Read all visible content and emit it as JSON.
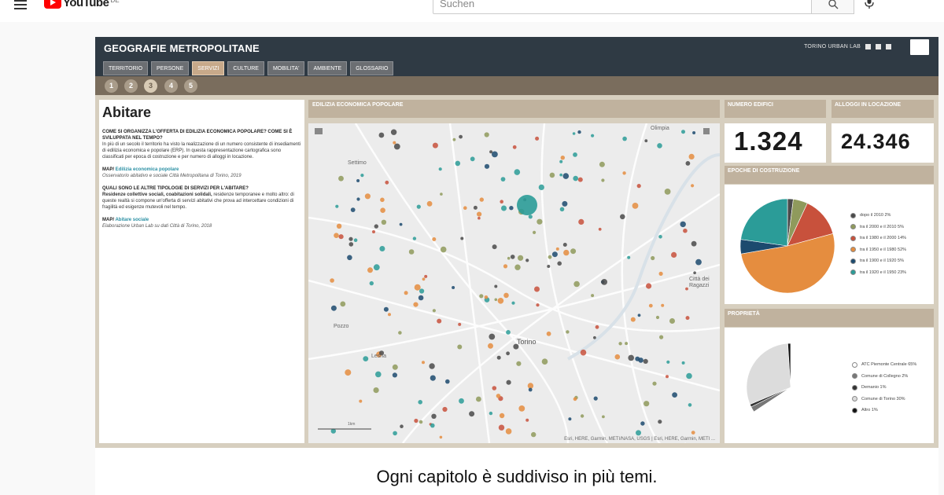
{
  "youtube": {
    "logo_text": "YouTube",
    "logo_region": "DE",
    "search_placeholder": "Suchen"
  },
  "dashboard": {
    "title": "GEOGRAFIE METROPOLITANE",
    "brand": "TORINO URBAN LAB",
    "tabs": [
      "TERRITORIO",
      "PERSONE",
      "SERVIZI",
      "CULTURE",
      "MOBILITA'",
      "AMBIENTE",
      "GLOSSARIO"
    ],
    "active_tab": "SERVIZI",
    "pages": [
      "1",
      "2",
      "3",
      "4",
      "5"
    ],
    "active_page": "3",
    "text_panel": {
      "title": "Abitare",
      "q1": "COME SI ORGANIZZA L'OFFERTA DI EDILIZIA ECONOMICA POPOLARE? COME SI È SVILUPPATA NEL TEMPO?",
      "p1": "In più di un secolo il territorio ha visto la realizzazione di un numero consistente di insediamenti di edilizia economica e popolare (ERP). In questa rappresentazione cartografica sono classificati per epoca di costruzione e per numero di alloggi in locazione.",
      "map1_prefix": "MAP/",
      "map1_link": "Edilizia economica popolare",
      "cite1": "Osservatorio abitativo e sociale Città Metropolitana di Torino, 2019",
      "q2": "QUALI SONO LE ALTRE TIPOLOGIE DI SERVIZI PER L'ABITARE?",
      "p2_bold": "Residenze collettive sociali, coabitazioni solidali,",
      "p2": "residenze temporanee e molto altro: di queste realtà si compone un'offerta di servizi abitativi che prova ad intercettare condizioni di fragilità ed esigenze mutevoli nel tempo.",
      "map2_prefix": "MAP/",
      "map2_link": "Abitare sociale",
      "cite2": "Elaborazione Urban Lab su dati Città di Torino, 2018"
    },
    "map": {
      "header": "EDILIZIA ECONOMICA POPOLARE",
      "labels": [
        "Settimo",
        "Olimpia",
        "Pozzo",
        "Torino",
        "Lesna",
        "Città dei Ragazzi"
      ],
      "scale": "1km",
      "attribution": "Esri, HERE, Garmin, METI/NASA, USGS | Esri, HERE, Garmin, METI ..."
    },
    "stats": {
      "numero_edifici_label": "NUMERO EDIFICI",
      "numero_edifici": "1.324",
      "alloggi_label": "ALLOGGI IN LOCAZIONE",
      "alloggi": "24.346"
    },
    "epoche": {
      "header": "EPOCHE DI COSTRUZIONE",
      "legend": [
        {
          "label": "dopo il 2010  2%",
          "color": "#4a4a4a"
        },
        {
          "label": "tra il 2000 e il 2010  5%",
          "color": "#8f9a5c"
        },
        {
          "label": "tra il 1980 e il 2000  14%",
          "color": "#c8513c"
        },
        {
          "label": "tra il 1950 e il 1980  52%",
          "color": "#e58d3f"
        },
        {
          "label": "tra il 1900 e il 1920  5%",
          "color": "#1c4a6e"
        },
        {
          "label": "tra il 1920 e il 1950  23%",
          "color": "#2b9c98"
        }
      ]
    },
    "proprieta": {
      "header": "PROPRIETÀ",
      "legend": [
        {
          "label": "ATC Piemonte Centrale  65%",
          "color": "#ffffff"
        },
        {
          "label": "Comune di Collegno  2%",
          "color": "#777777"
        },
        {
          "label": "Demanio  1%",
          "color": "#333333"
        },
        {
          "label": "Comune di Torino  30%",
          "color": "#dcdcdc"
        },
        {
          "label": "Altro  1%",
          "color": "#111111"
        }
      ]
    }
  },
  "subtitle": "Ogni capitolo è suddiviso in più temi.",
  "chart_data": [
    {
      "type": "pie",
      "title": "EPOCHE DI COSTRUZIONE",
      "categories": [
        "dopo il 2010",
        "tra il 2000 e il 2010",
        "tra il 1980 e il 2000",
        "tra il 1950 e il 1980",
        "tra il 1900 e il 1920",
        "tra il 1920 e il 1950"
      ],
      "values": [
        2,
        5,
        14,
        52,
        5,
        23
      ],
      "colors": [
        "#4a4a4a",
        "#8f9a5c",
        "#c8513c",
        "#e58d3f",
        "#1c4a6e",
        "#2b9c98"
      ]
    },
    {
      "type": "pie",
      "title": "PROPRIETÀ",
      "categories": [
        "ATC Piemonte Centrale",
        "Comune di Collegno",
        "Demanio",
        "Comune di Torino",
        "Altro"
      ],
      "values": [
        65,
        2,
        1,
        30,
        1
      ],
      "colors": [
        "#ffffff",
        "#777777",
        "#333333",
        "#dcdcdc",
        "#111111"
      ]
    }
  ]
}
